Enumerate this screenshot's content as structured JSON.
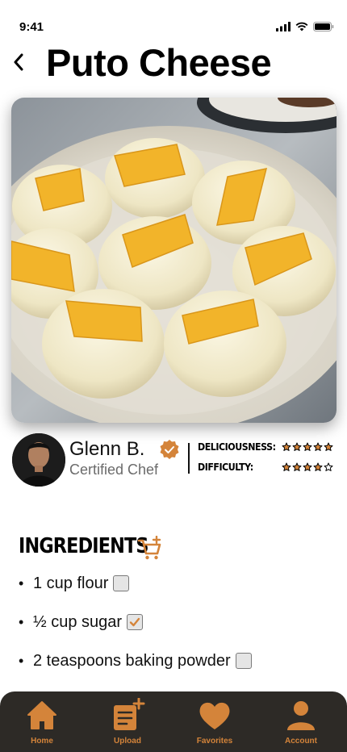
{
  "status_bar": {
    "time": "9:41"
  },
  "header": {
    "title": "Puto Cheese"
  },
  "chef": {
    "name": "Glenn B.",
    "role": "Certified Chef"
  },
  "ratings": [
    {
      "label": "DELICIOUSNESS:",
      "stars": 5,
      "max": 5
    },
    {
      "label": "DIFFICULTY:",
      "stars": 4,
      "max": 5
    }
  ],
  "ingredients": {
    "title": "INGREDIENTS",
    "items": [
      {
        "bullet": "•",
        "text": "1 cup flour",
        "checked": false
      },
      {
        "bullet": "•",
        "text": "½ cup sugar",
        "checked": true
      },
      {
        "bullet": "•",
        "text": "2 teaspoons baking powder",
        "checked": false
      }
    ]
  },
  "nav": {
    "items": [
      {
        "label": "Home",
        "icon": "home-icon"
      },
      {
        "label": "Upload",
        "icon": "upload-note-icon"
      },
      {
        "label": "Favorites",
        "icon": "heart-icon"
      },
      {
        "label": "Account",
        "icon": "user-icon"
      }
    ]
  },
  "colors": {
    "accent": "#d4843a",
    "nav_bg": "#2d2a26",
    "cheese": "#f2b42a"
  }
}
